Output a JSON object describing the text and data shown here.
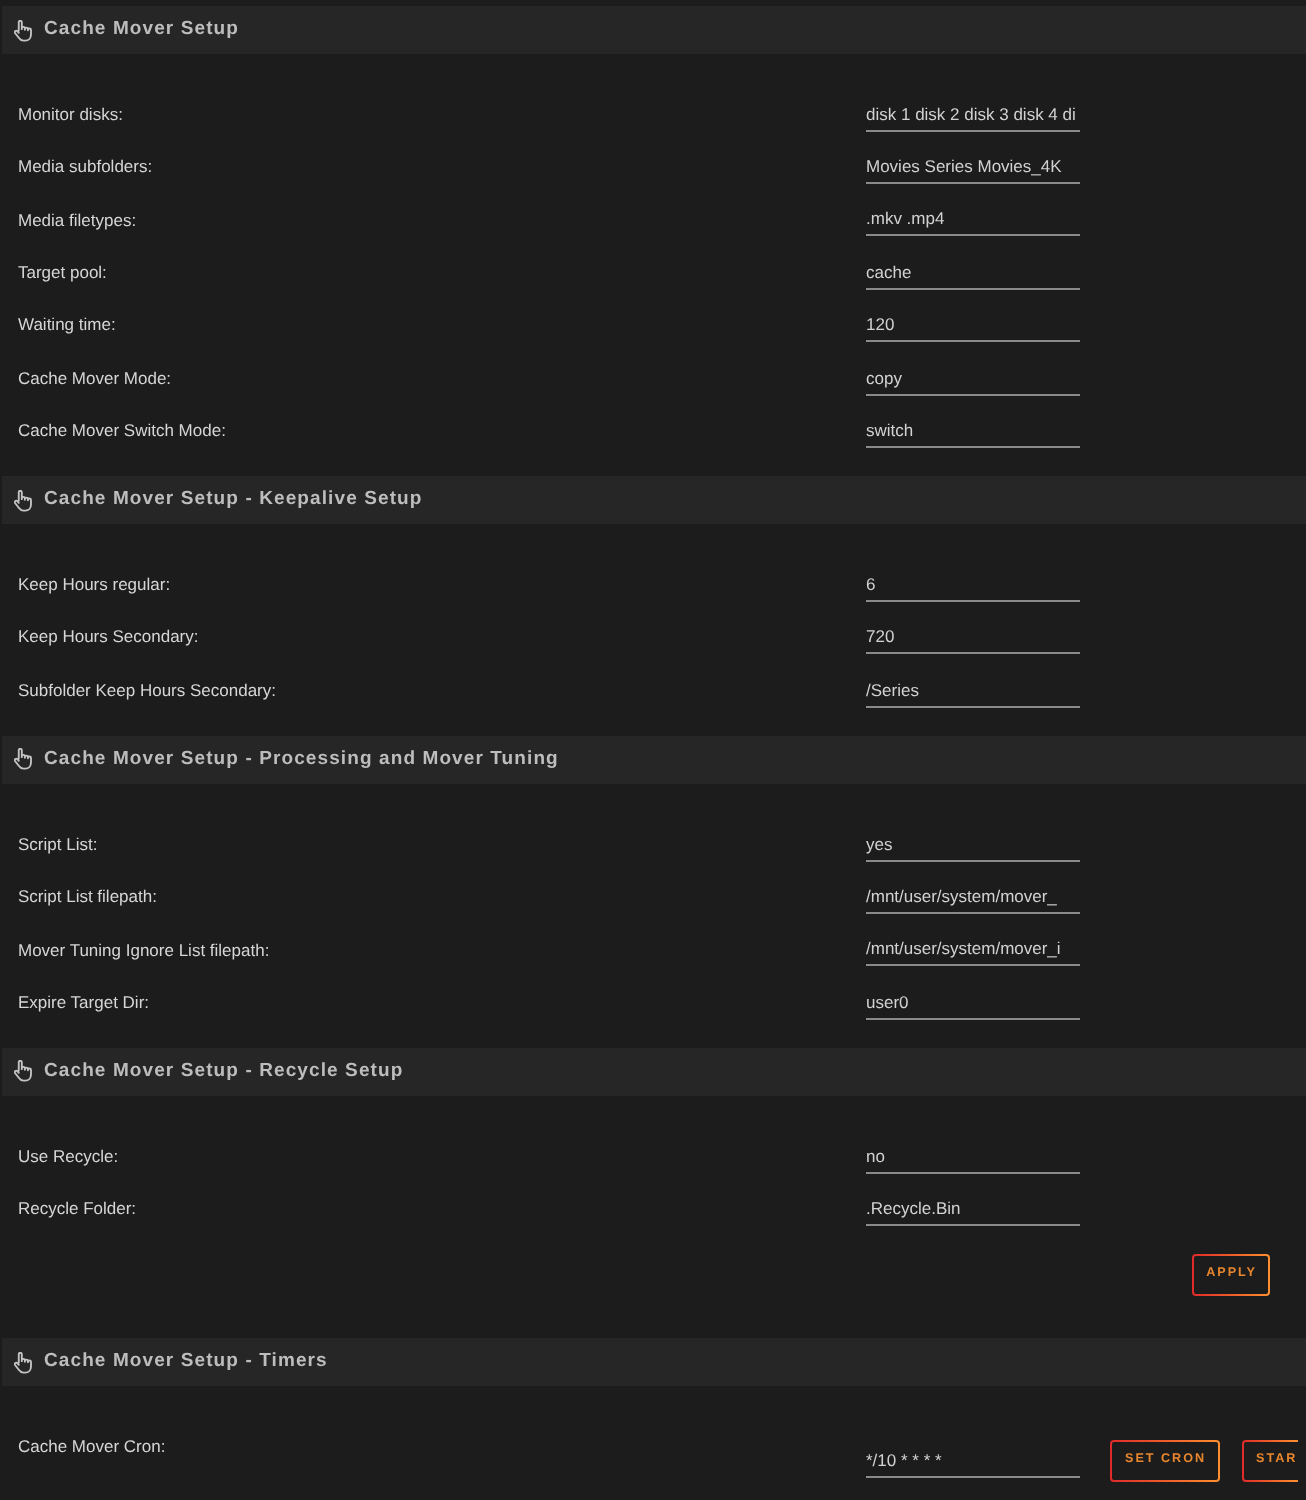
{
  "sections": [
    {
      "title": "Cache Mover Setup",
      "fields": [
        {
          "label": "Monitor disks:",
          "value": "disk 1 disk 2 disk 3 disk 4 di"
        },
        {
          "label": "Media subfolders:",
          "value": "Movies Series Movies_4K"
        },
        {
          "label": "Media filetypes:",
          "value": ".mkv .mp4"
        },
        {
          "label": "Target pool:",
          "value": "cache"
        },
        {
          "label": "Waiting time:",
          "value": "120"
        },
        {
          "label": "Cache Mover Mode:",
          "value": "copy"
        },
        {
          "label": "Cache Mover Switch Mode:",
          "value": "switch"
        }
      ]
    },
    {
      "title": "Cache Mover Setup - Keepalive Setup",
      "fields": [
        {
          "label": "Keep Hours regular:",
          "value": "6"
        },
        {
          "label": "Keep Hours Secondary:",
          "value": "720"
        },
        {
          "label": "Subfolder Keep Hours Secondary:",
          "value": "/Series"
        }
      ]
    },
    {
      "title": "Cache Mover Setup - Processing and Mover Tuning",
      "fields": [
        {
          "label": "Script List:",
          "value": "yes"
        },
        {
          "label": "Script List filepath:",
          "value": "/mnt/user/system/mover_"
        },
        {
          "label": "Mover Tuning Ignore List filepath:",
          "value": "/mnt/user/system/mover_i"
        },
        {
          "label": "Expire Target Dir:",
          "value": "user0"
        }
      ]
    },
    {
      "title": "Cache Mover Setup - Recycle Setup",
      "fields": [
        {
          "label": "Use Recycle:",
          "value": "no"
        },
        {
          "label": "Recycle Folder:",
          "value": ".Recycle.Bin"
        }
      ],
      "buttons": [
        "APPLY"
      ]
    },
    {
      "title": "Cache Mover Setup - Timers",
      "fields": [
        {
          "label": "Cache Mover Cron:",
          "value": "*/10 * * * *",
          "buttons": [
            "SET CRON",
            "STAR"
          ]
        }
      ]
    }
  ]
}
